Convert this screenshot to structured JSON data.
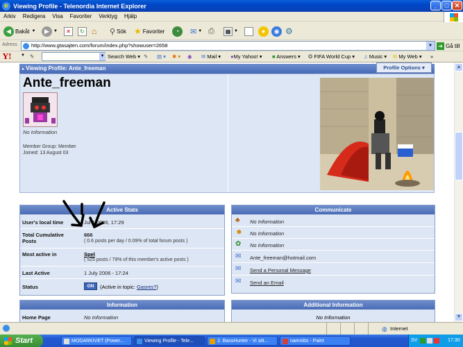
{
  "window": {
    "title": "Viewing Profile - Telenordia Internet Explorer"
  },
  "menu": [
    "Arkiv",
    "Redigera",
    "Visa",
    "Favoriter",
    "Verktyg",
    "Hjälp"
  ],
  "toolbar": {
    "back": "Bakåt",
    "search": "Sök",
    "favorites": "Favoriter"
  },
  "address": {
    "label": "Adress",
    "url": "http://www.gtasajten.com/forum/index.php?showuser=2658",
    "go": "Gå till"
  },
  "yahoo": {
    "search_label": "Search Web",
    "mail": "Mail",
    "my_yahoo": "My Yahoo!",
    "answers": "Answers",
    "fifa": "FIFA World Cup",
    "music": "Music",
    "my_web": "My Web"
  },
  "profile": {
    "header": "Viewing Profile: Ante_freeman",
    "options": "Profile Options",
    "username": "Ante_freeman",
    "no_info": "No Information",
    "member_group": "Member Group: Member",
    "joined": "Joined: 13 August 03"
  },
  "active_stats": {
    "title": "Active Stats",
    "local_time_label": "User's local time",
    "local_time": "Jul 1 2006, 17:29",
    "posts_label": "Total Cumulative Posts",
    "posts": "666",
    "posts_detail": "( 0.6 posts per day / 0.09% of total forum posts )",
    "active_in_label": "Most active in",
    "active_in": "Spel",
    "active_in_detail": "( 525 posts / 79% of this member's active posts )",
    "last_active_label": "Last Active",
    "last_active": "1 July 2006 - 17:24",
    "status_label": "Status",
    "status_badge": "ON",
    "status_prefix": "(Active in topic:",
    "status_topic": "Gasres?",
    "status_suffix": ")"
  },
  "communicate": {
    "title": "Communicate",
    "rows": [
      "No Information",
      "No Information",
      "No Information",
      "Ante_freeman@hotmail.com",
      "Send a Personal Message",
      "Send an Email"
    ]
  },
  "information": {
    "title": "Information",
    "home_label": "Home Page",
    "home_value": "No Information"
  },
  "additional": {
    "title": "Additional Information",
    "value": "No Information"
  },
  "statusbar": {
    "zone": "Internet"
  },
  "taskbar": {
    "start": "Start",
    "tasks": [
      "MODARKIVET (Power...",
      "Viewing Profile - Tele...",
      "2. BassHunter - Vi sitt...",
      "namnlös - Paint"
    ],
    "lang": "SV",
    "clock": "17:30"
  }
}
